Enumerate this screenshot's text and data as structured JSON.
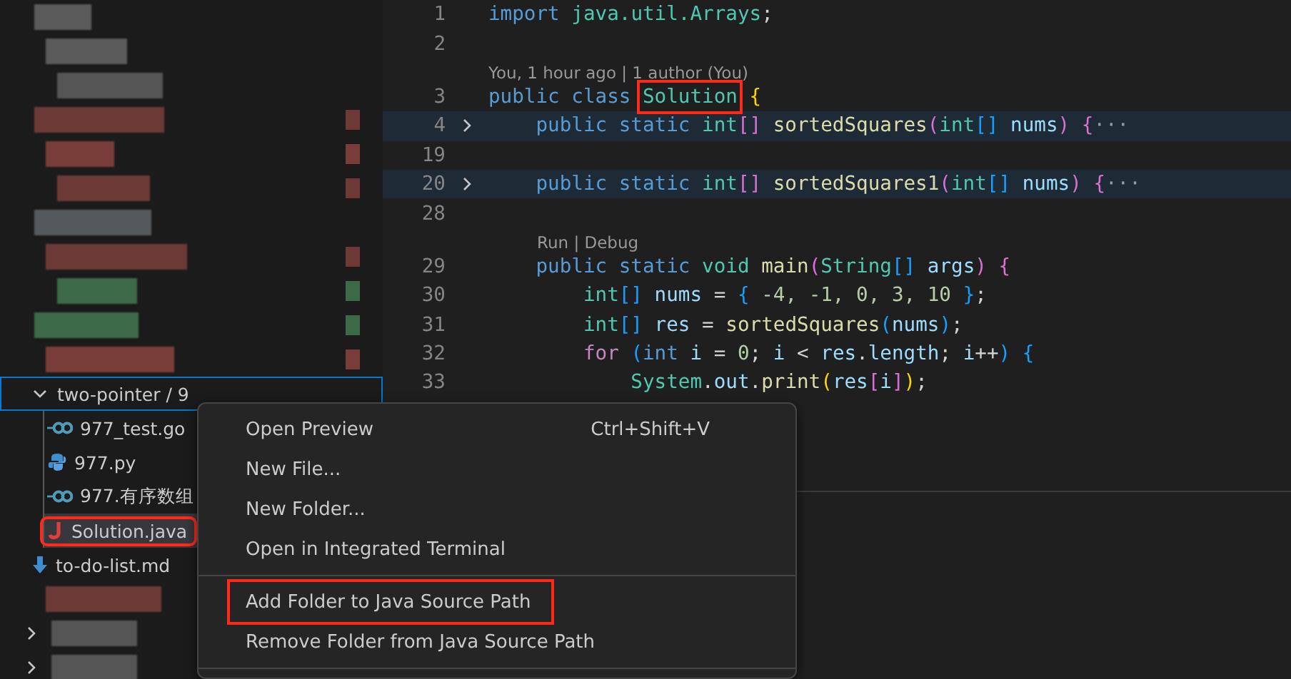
{
  "sidebar": {
    "items": [
      {
        "kind": "redacted",
        "color": "#5a5a5a",
        "decoration": false
      },
      {
        "kind": "redacted",
        "color": "#5a5a5a",
        "decoration": false
      },
      {
        "kind": "redacted",
        "color": "#555555",
        "decoration": false
      },
      {
        "kind": "redacted",
        "color": "#6e3a38",
        "decoration": true
      },
      {
        "kind": "redacted",
        "color": "#7a3e3a",
        "decoration": true
      },
      {
        "kind": "redacted",
        "color": "#6e3a38",
        "decoration": true
      },
      {
        "kind": "redacted",
        "color": "#55595c",
        "decoration": false
      },
      {
        "kind": "redacted",
        "color": "#6e3a38",
        "decoration": true
      },
      {
        "kind": "redacted",
        "color": "#3d6a48",
        "decoration": true
      },
      {
        "kind": "redacted",
        "color": "#3d6a48",
        "decoration": true
      },
      {
        "kind": "redacted",
        "color": "#7a3e3a",
        "decoration": true
      },
      {
        "kind": "folder",
        "label": "two-pointer / 9",
        "expanded": true,
        "focused": true,
        "children": [
          {
            "kind": "go-file",
            "label": "977_test.go",
            "selected": false,
            "highlighted": false
          },
          {
            "kind": "python-file",
            "label": "977.py",
            "selected": false,
            "highlighted": false
          },
          {
            "kind": "go-file",
            "label": "977.有序数组",
            "selected": false,
            "highlighted": false
          },
          {
            "kind": "java-file",
            "label": "Solution.java",
            "selected": true,
            "highlighted": true
          }
        ]
      },
      {
        "kind": "markdown-file",
        "label": "to-do-list.md",
        "selected": false,
        "highlighted": false
      },
      {
        "kind": "redacted",
        "color": "#6e3a38",
        "decoration": false
      },
      {
        "kind": "redacted-folder",
        "color": "#555555",
        "expanded": false
      },
      {
        "kind": "redacted-folder",
        "color": "#555555",
        "expanded": false
      }
    ]
  },
  "editor": {
    "lines": [
      {
        "kind": "code",
        "number": "1",
        "folded": false,
        "tokens": [
          {
            "text": "import ",
            "kind": "kw"
          },
          {
            "text": "java.util.Arrays",
            "kind": "type"
          },
          {
            "text": ";",
            "kind": "punct"
          }
        ]
      },
      {
        "kind": "code",
        "number": "2",
        "folded": false
      },
      {
        "kind": "lens",
        "text": "You, 1 hour ago | 1 author (You)"
      },
      {
        "kind": "code",
        "number": "3",
        "folded": false,
        "tokens": [
          {
            "text": "public class ",
            "kind": "kw"
          },
          {
            "text": "Solution",
            "kind": "type",
            "boxed": true
          },
          {
            "text": " {",
            "kind": "b1"
          }
        ]
      },
      {
        "kind": "code",
        "number": "4",
        "folded": true,
        "tokens": [
          {
            "text": "    public static ",
            "kind": "kw"
          },
          {
            "text": "int",
            "kind": "type"
          },
          {
            "text": "[] ",
            "kind": "b2"
          },
          {
            "text": "sortedSquares",
            "kind": "fn"
          },
          {
            "text": "(",
            "kind": "b2"
          },
          {
            "text": "int",
            "kind": "type"
          },
          {
            "text": "[]",
            "kind": "b3"
          },
          {
            "text": " nums",
            "kind": "var"
          },
          {
            "text": ") {",
            "kind": "b2"
          },
          {
            "text": "···",
            "kind": "fold"
          }
        ]
      },
      {
        "kind": "code",
        "number": "19",
        "folded": false
      },
      {
        "kind": "code",
        "number": "20",
        "folded": true,
        "tokens": [
          {
            "text": "    public static ",
            "kind": "kw"
          },
          {
            "text": "int",
            "kind": "type"
          },
          {
            "text": "[] ",
            "kind": "b2"
          },
          {
            "text": "sortedSquares1",
            "kind": "fn"
          },
          {
            "text": "(",
            "kind": "b2"
          },
          {
            "text": "int",
            "kind": "type"
          },
          {
            "text": "[]",
            "kind": "b3"
          },
          {
            "text": " nums",
            "kind": "var"
          },
          {
            "text": ") {",
            "kind": "b2"
          },
          {
            "text": "···",
            "kind": "fold"
          }
        ]
      },
      {
        "kind": "code",
        "number": "28",
        "folded": false
      },
      {
        "kind": "lens",
        "text": "Run | Debug"
      },
      {
        "kind": "code",
        "number": "29",
        "folded": false,
        "tokens": [
          {
            "text": "    public static ",
            "kind": "kw"
          },
          {
            "text": "void ",
            "kind": "type"
          },
          {
            "text": "main",
            "kind": "fn"
          },
          {
            "text": "(",
            "kind": "b2"
          },
          {
            "text": "String",
            "kind": "type"
          },
          {
            "text": "[]",
            "kind": "b3"
          },
          {
            "text": " args",
            "kind": "var"
          },
          {
            "text": ") {",
            "kind": "b2"
          }
        ]
      },
      {
        "kind": "code",
        "number": "30",
        "folded": false,
        "tokens": [
          {
            "text": "        int",
            "kind": "type"
          },
          {
            "text": "[]",
            "kind": "b3"
          },
          {
            "text": " nums",
            "kind": "var"
          },
          {
            "text": " = ",
            "kind": "punct"
          },
          {
            "text": "{",
            "kind": "b3"
          },
          {
            "text": " -4, -1, 0, 3, 10 ",
            "kind": "num"
          },
          {
            "text": "}",
            "kind": "b3"
          },
          {
            "text": ";",
            "kind": "punct"
          }
        ]
      },
      {
        "kind": "code",
        "number": "31",
        "folded": false,
        "tokens": [
          {
            "text": "        int",
            "kind": "type"
          },
          {
            "text": "[]",
            "kind": "b3"
          },
          {
            "text": " res",
            "kind": "var"
          },
          {
            "text": " = ",
            "kind": "punct"
          },
          {
            "text": "sortedSquares",
            "kind": "fn"
          },
          {
            "text": "(",
            "kind": "b3"
          },
          {
            "text": "nums",
            "kind": "var"
          },
          {
            "text": ")",
            "kind": "b3"
          },
          {
            "text": ";",
            "kind": "punct"
          }
        ]
      },
      {
        "kind": "code",
        "number": "32",
        "folded": false,
        "tokens": [
          {
            "text": "        for ",
            "kind": "ctrl"
          },
          {
            "text": "(",
            "kind": "b3"
          },
          {
            "text": "int",
            "kind": "kw"
          },
          {
            "text": " i",
            "kind": "var"
          },
          {
            "text": " = ",
            "kind": "punct"
          },
          {
            "text": "0",
            "kind": "num"
          },
          {
            "text": "; ",
            "kind": "punct"
          },
          {
            "text": "i",
            "kind": "var"
          },
          {
            "text": " < ",
            "kind": "punct"
          },
          {
            "text": "res",
            "kind": "var"
          },
          {
            "text": ".",
            "kind": "punct"
          },
          {
            "text": "length",
            "kind": "prop"
          },
          {
            "text": "; ",
            "kind": "punct"
          },
          {
            "text": "i",
            "kind": "var"
          },
          {
            "text": "++",
            "kind": "punct"
          },
          {
            "text": ") {",
            "kind": "b3"
          }
        ]
      },
      {
        "kind": "code",
        "number": "33",
        "folded": false,
        "tokens": [
          {
            "text": "            System",
            "kind": "type"
          },
          {
            "text": ".",
            "kind": "punct"
          },
          {
            "text": "out",
            "kind": "prop"
          },
          {
            "text": ".",
            "kind": "punct"
          },
          {
            "text": "print",
            "kind": "fn"
          },
          {
            "text": "(",
            "kind": "b1"
          },
          {
            "text": "res",
            "kind": "var"
          },
          {
            "text": "[",
            "kind": "b2"
          },
          {
            "text": "i",
            "kind": "var"
          },
          {
            "text": "]",
            "kind": "b2"
          },
          {
            "text": ")",
            "kind": "b1"
          },
          {
            "text": ";",
            "kind": "punct"
          }
        ]
      }
    ]
  },
  "context_menu": {
    "groups": [
      [
        {
          "label": "Open Preview",
          "shortcut": "Ctrl+Shift+V",
          "highlighted": false
        },
        {
          "label": "New File...",
          "highlighted": false
        },
        {
          "label": "New Folder...",
          "highlighted": false
        },
        {
          "label": "Open in Integrated Terminal",
          "highlighted": false
        }
      ],
      [
        {
          "label": "Add Folder to Java Source Path",
          "highlighted": true
        },
        {
          "label": "Remove Folder from Java Source Path",
          "highlighted": false
        }
      ]
    ]
  }
}
